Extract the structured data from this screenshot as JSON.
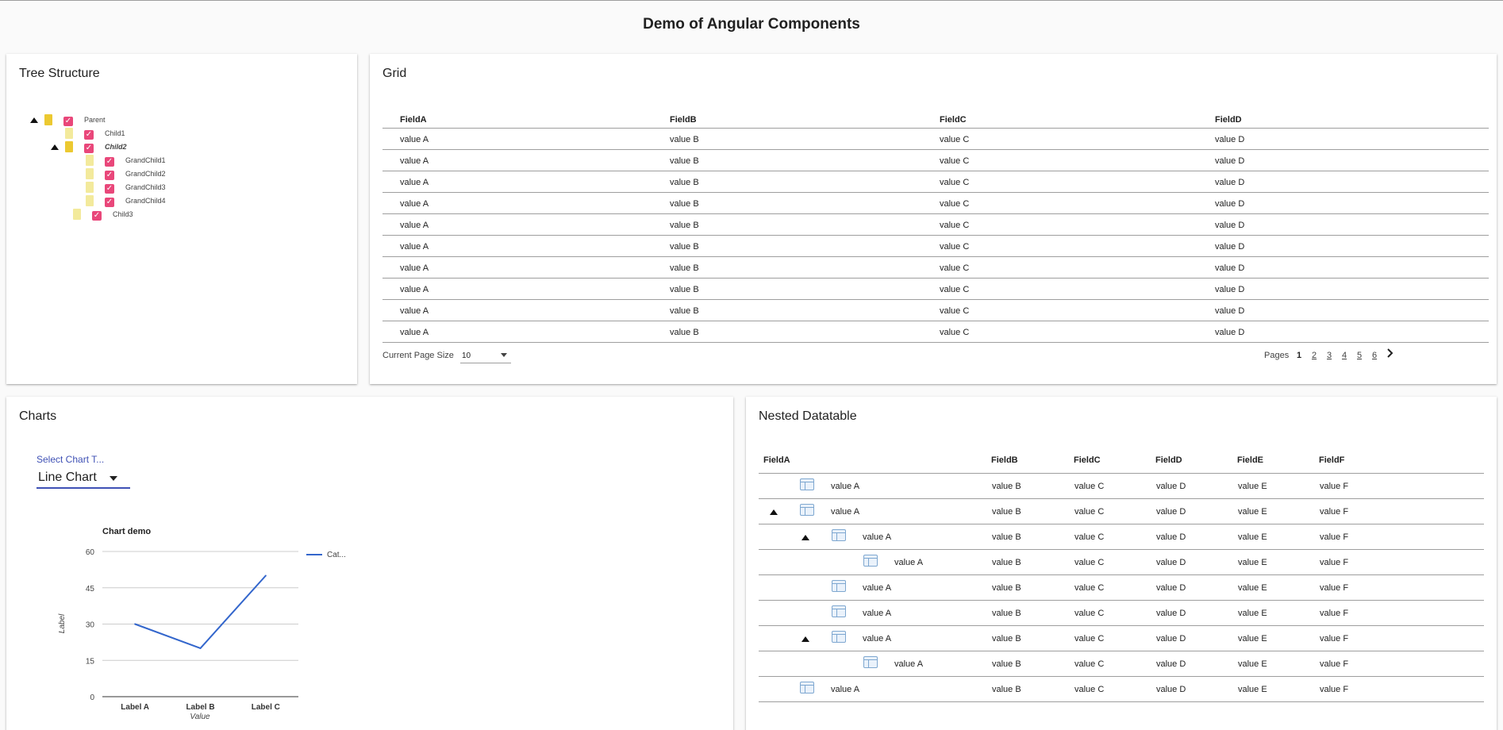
{
  "page": {
    "title": "Demo of Angular Components"
  },
  "tree": {
    "title": "Tree Structure",
    "nodes": [
      {
        "label": "Parent",
        "expanded": true
      },
      {
        "label": "Child1"
      },
      {
        "label": "Child2",
        "expanded": true
      },
      {
        "label": "GrandChild1"
      },
      {
        "label": "GrandChild2"
      },
      {
        "label": "GrandChild3"
      },
      {
        "label": "GrandChild4"
      },
      {
        "label": "Child3"
      }
    ],
    "check_glyph": "✓"
  },
  "grid": {
    "title": "Grid",
    "columns": [
      "FieldA",
      "FieldB",
      "FieldC",
      "FieldD"
    ],
    "rows": [
      [
        "value A",
        "value B",
        "value C",
        "value D"
      ],
      [
        "value A",
        "value B",
        "value C",
        "value D"
      ],
      [
        "value A",
        "value B",
        "value C",
        "value D"
      ],
      [
        "value A",
        "value B",
        "value C",
        "value D"
      ],
      [
        "value A",
        "value B",
        "value C",
        "value D"
      ],
      [
        "value A",
        "value B",
        "value C",
        "value D"
      ],
      [
        "value A",
        "value B",
        "value C",
        "value D"
      ],
      [
        "value A",
        "value B",
        "value C",
        "value D"
      ],
      [
        "value A",
        "value B",
        "value C",
        "value D"
      ],
      [
        "value A",
        "value B",
        "value C",
        "value D"
      ]
    ],
    "page_size_label": "Current Page Size",
    "page_size": "10",
    "pages_label": "Pages",
    "pages": [
      "1",
      "2",
      "3",
      "4",
      "5",
      "6"
    ],
    "current_page": "1",
    "next_glyph": "›"
  },
  "charts": {
    "title": "Charts",
    "select_label": "Select Chart T...",
    "select_value": "Line Chart",
    "chart_data": {
      "type": "line",
      "title": "Chart demo",
      "categories": [
        "Label A",
        "Label B",
        "Label C"
      ],
      "series": [
        {
          "name": "Cat...",
          "values": [
            30,
            20,
            50
          ]
        }
      ],
      "xlabel": "Value",
      "ylabel": "Label",
      "ylim": [
        0,
        60
      ],
      "yticks": [
        0,
        15,
        30,
        45,
        60
      ],
      "legend_position": "right",
      "color": "#3366cc",
      "grid": true
    }
  },
  "nested": {
    "title": "Nested Datatable",
    "columns": [
      "FieldA",
      "FieldB",
      "FieldC",
      "FieldD",
      "FieldE",
      "FieldF"
    ],
    "rows": [
      {
        "level": 0,
        "expanded": false,
        "values": [
          "value A",
          "value B",
          "value C",
          "value D",
          "value E",
          "value F"
        ]
      },
      {
        "level": 0,
        "expanded": true,
        "values": [
          "value A",
          "value B",
          "value C",
          "value D",
          "value E",
          "value F"
        ]
      },
      {
        "level": 1,
        "expanded": true,
        "values": [
          "value A",
          "value B",
          "value C",
          "value D",
          "value E",
          "value F"
        ]
      },
      {
        "level": 2,
        "expanded": false,
        "values": [
          "value A",
          "value B",
          "value C",
          "value D",
          "value E",
          "value F"
        ]
      },
      {
        "level": 1,
        "expanded": false,
        "values": [
          "value A",
          "value B",
          "value C",
          "value D",
          "value E",
          "value F"
        ]
      },
      {
        "level": 1,
        "expanded": false,
        "values": [
          "value A",
          "value B",
          "value C",
          "value D",
          "value E",
          "value F"
        ]
      },
      {
        "level": 1,
        "expanded": true,
        "values": [
          "value A",
          "value B",
          "value C",
          "value D",
          "value E",
          "value F"
        ]
      },
      {
        "level": 2,
        "expanded": false,
        "values": [
          "value A",
          "value B",
          "value C",
          "value D",
          "value E",
          "value F"
        ]
      },
      {
        "level": 0,
        "expanded": false,
        "values": [
          "value A",
          "value B",
          "value C",
          "value D",
          "value E",
          "value F"
        ]
      }
    ]
  },
  "colors": {
    "accent": "#3f51b5",
    "checkbox": "#e9477a",
    "line": "#3366cc"
  }
}
